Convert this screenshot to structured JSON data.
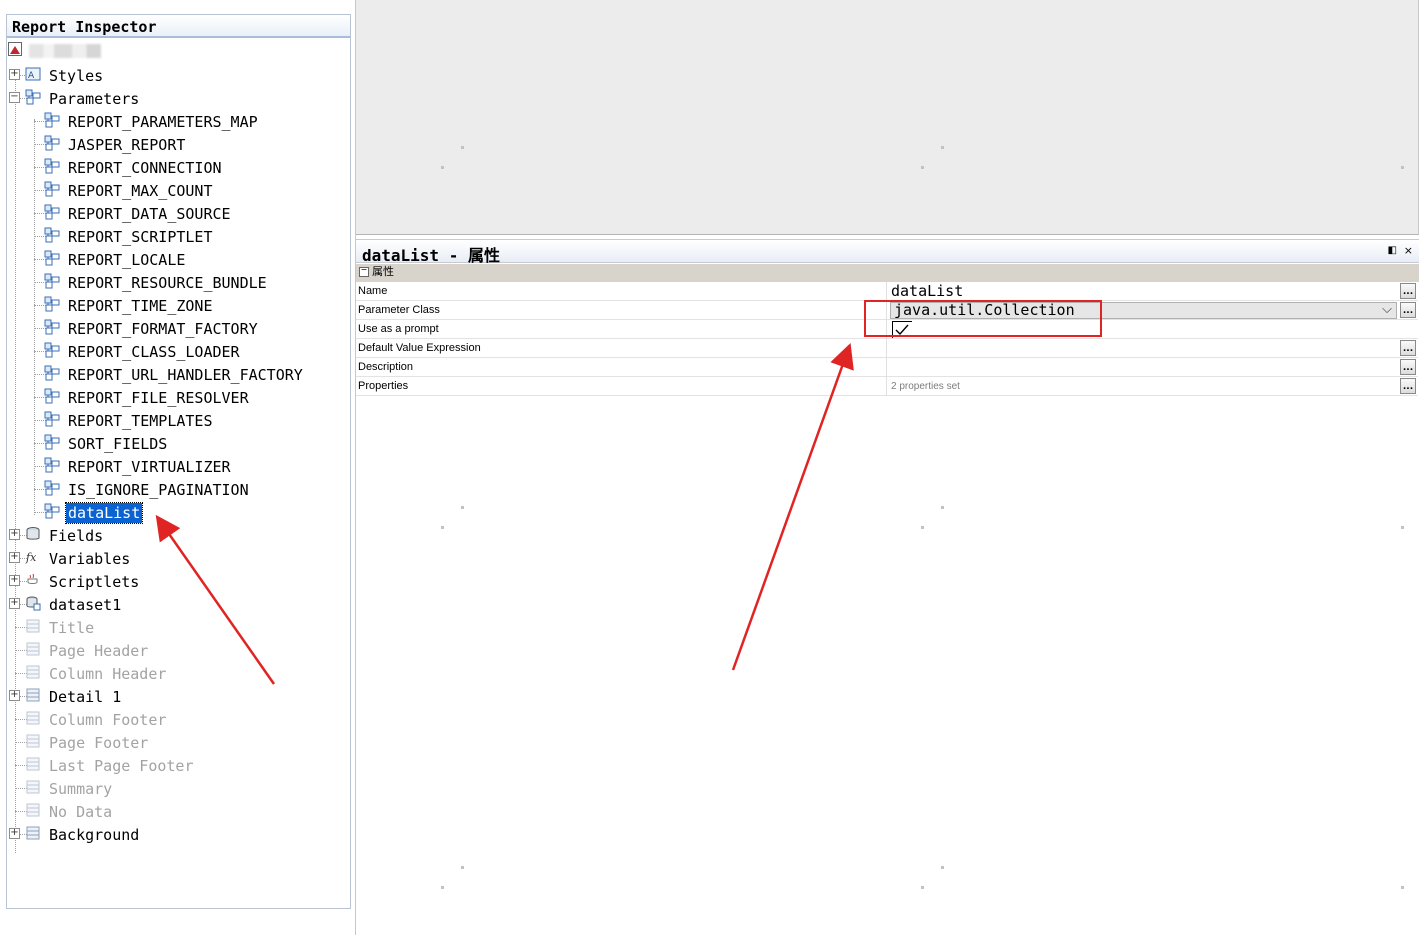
{
  "inspector": {
    "title": "Report Inspector",
    "nodes": {
      "styles": "Styles",
      "parameters": "Parameters",
      "fields": "Fields",
      "variables": "Variables",
      "scriptlets": "Scriptlets",
      "dataset1": "dataset1",
      "title": "Title",
      "page_header": "Page Header",
      "column_header": "Column Header",
      "detail1": "Detail 1",
      "column_footer": "Column Footer",
      "page_footer": "Page Footer",
      "last_page_footer": "Last Page Footer",
      "summary": "Summary",
      "no_data": "No Data",
      "background": "Background"
    },
    "parameters": [
      "REPORT_PARAMETERS_MAP",
      "JASPER_REPORT",
      "REPORT_CONNECTION",
      "REPORT_MAX_COUNT",
      "REPORT_DATA_SOURCE",
      "REPORT_SCRIPTLET",
      "REPORT_LOCALE",
      "REPORT_RESOURCE_BUNDLE",
      "REPORT_TIME_ZONE",
      "REPORT_FORMAT_FACTORY",
      "REPORT_CLASS_LOADER",
      "REPORT_URL_HANDLER_FACTORY",
      "REPORT_FILE_RESOLVER",
      "REPORT_TEMPLATES",
      "SORT_FIELDS",
      "REPORT_VIRTUALIZER",
      "IS_IGNORE_PAGINATION",
      "dataList"
    ],
    "selected": "dataList"
  },
  "properties": {
    "title": "dataList - 属性",
    "category": "属性",
    "float_glyph": "◧",
    "close_glyph": "×",
    "rows": {
      "name": {
        "label": "Name",
        "value": "dataList"
      },
      "parameter_class": {
        "label": "Parameter Class",
        "value": "java.util.Collection"
      },
      "use_as_prompt": {
        "label": "Use as a prompt",
        "checked": true
      },
      "default_value_expression": {
        "label": "Default Value Expression",
        "value": ""
      },
      "description": {
        "label": "Description",
        "value": ""
      },
      "properties": {
        "label": "Properties",
        "value": "2 properties set"
      }
    },
    "ellipsis": "..."
  },
  "colors": {
    "selection": "#0a63d1",
    "annotation": "#e02424",
    "disabled_text": "#a3a3a3"
  }
}
